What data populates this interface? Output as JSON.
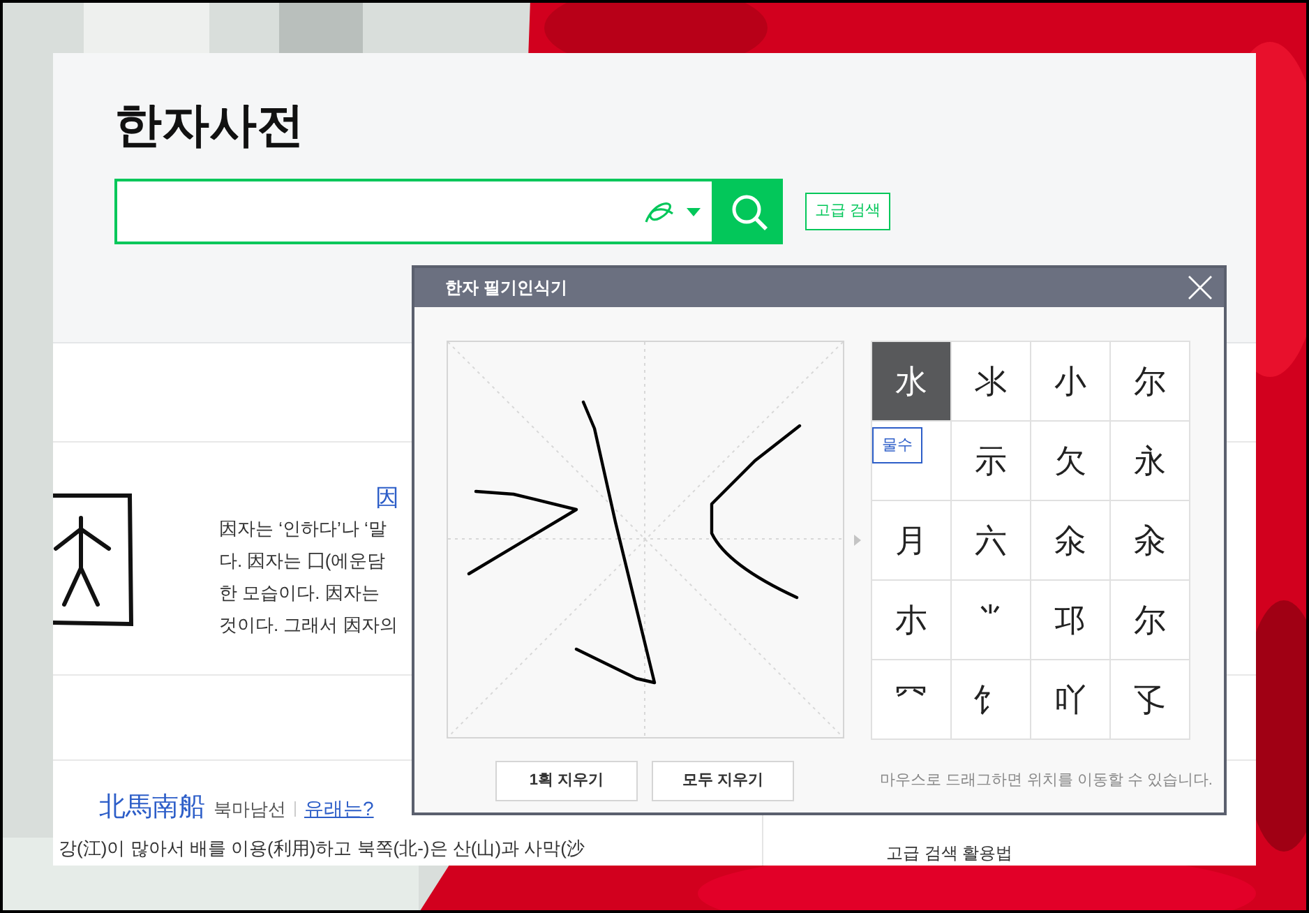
{
  "page": {
    "title": "한자사전",
    "search": {
      "advanced_button": "고급 검색"
    },
    "entry": {
      "heading": "因",
      "lines": [
        "因자는 ‘인하다’나 ‘말",
        "다. 因자는 囗(에운담",
        "한 모습이다. 因자는",
        "것이다. 그래서 因자의"
      ]
    },
    "idiom": {
      "hanja": "北馬南船",
      "reading": "북마남선",
      "link": "유래는?",
      "text": "강(江)이 많아서 배를 이용(利用)하고 북쪽(北-)은 산(山)과 사막(沙"
    },
    "side_link": "고급 검색 활용법"
  },
  "dialog": {
    "title": "한자 필기인식기",
    "candidates": [
      {
        "char": "水",
        "selected": true
      },
      {
        "char": "氺",
        "selected": false
      },
      {
        "char": "小",
        "selected": false
      },
      {
        "char": "尔",
        "selected": false
      },
      {
        "selected": false
      },
      {
        "char": "示",
        "selected": false
      },
      {
        "char": "欠",
        "selected": false
      },
      {
        "char": "永",
        "selected": false
      },
      {
        "char": "月",
        "selected": false
      },
      {
        "char": "六",
        "selected": false
      },
      {
        "char": "氽",
        "selected": false
      },
      {
        "char": "汆",
        "selected": false
      },
      {
        "char": "朩",
        "selected": false
      },
      {
        "char": "⺌",
        "selected": false
      },
      {
        "char": "邛",
        "selected": false
      },
      {
        "char": "尔",
        "selected": false
      },
      {
        "char": "⺳",
        "selected": false
      },
      {
        "char": "饣",
        "selected": false
      },
      {
        "char": "吖",
        "selected": false
      },
      {
        "char": "孓",
        "selected": false
      }
    ],
    "tooltip": "물수",
    "buttons": [
      "1획 지우기",
      "모두 지우기"
    ],
    "hint": "마우스로 드래그하면 위치를 이동할 수 있습니다."
  }
}
